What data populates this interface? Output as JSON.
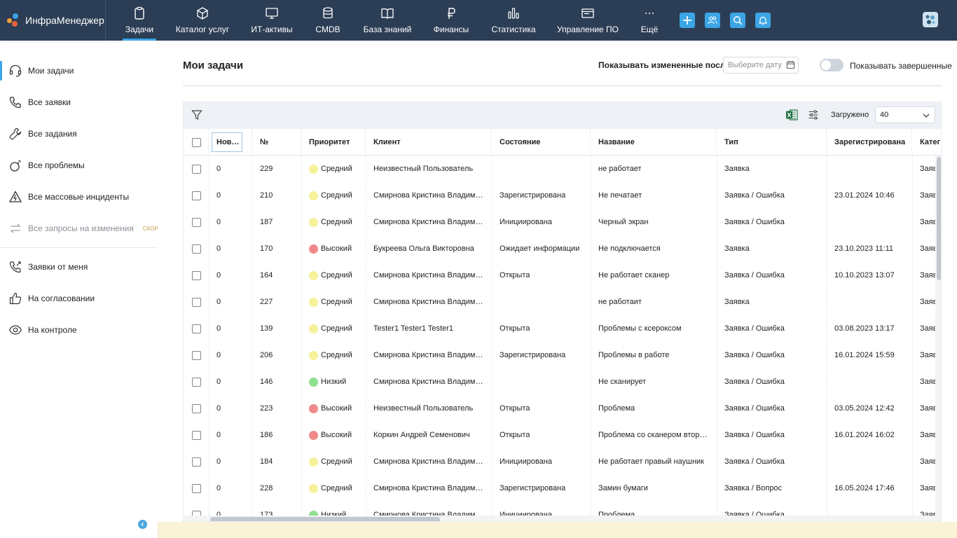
{
  "app": {
    "name": "ИнфраМенеджер"
  },
  "nav": [
    {
      "label": "Задачи",
      "icon": "clipboard-icon",
      "active": true
    },
    {
      "label": "Каталог услуг",
      "icon": "cube-icon"
    },
    {
      "label": "ИТ-активы",
      "icon": "monitor-icon"
    },
    {
      "label": "CMDB",
      "icon": "database-icon"
    },
    {
      "label": "База знаний",
      "icon": "book-icon"
    },
    {
      "label": "Финансы",
      "icon": "ruble-icon"
    },
    {
      "label": "Статистика",
      "icon": "bar-chart-icon"
    },
    {
      "label": "Управление ПО",
      "icon": "software-window-icon"
    },
    {
      "label": "Ещё",
      "icon": "more-icon"
    }
  ],
  "top_actions": [
    "plus-icon",
    "users-icon",
    "search-icon",
    "bell-icon"
  ],
  "sidebar": {
    "items": [
      {
        "label": "Мои задачи",
        "icon": "headset-icon",
        "active": true
      },
      {
        "label": "Все заявки",
        "icon": "phone-icon"
      },
      {
        "label": "Все задания",
        "icon": "wrench-icon"
      },
      {
        "label": "Все проблемы",
        "icon": "bomb-icon"
      },
      {
        "label": "Все массовые инциденты",
        "icon": "warning-bolt-icon"
      },
      {
        "label": "Все запросы на изменения",
        "icon": "swap-arrows-icon",
        "disabled": true,
        "badge": "СКОРО"
      },
      {
        "label": "Заявки от меня",
        "icon": "phone-outgoing-icon"
      },
      {
        "label": "На согласовании",
        "icon": "thumbs-up-icon"
      },
      {
        "label": "На контроле",
        "icon": "eye-icon"
      }
    ]
  },
  "header": {
    "title": "Мои задачи",
    "changed_after_label": "Показывать измененные после",
    "date_placeholder": "Выберите дату",
    "show_completed_label": "Показывать завершенные",
    "show_completed": false
  },
  "toolbar": {
    "loaded_label": "Загружено",
    "loaded_value": "40"
  },
  "colors": {
    "accent": "#3ba5e6",
    "topbar": "#2c3e55",
    "priority_medium": "#f7f19a",
    "priority_high": "#f08a8a",
    "priority_low": "#8fe08f"
  },
  "columns": [
    "Нов…",
    "№",
    "Приоритет",
    "Клиент",
    "Состояние",
    "Название",
    "Тип",
    "Зарегистрирована",
    "Катег"
  ],
  "rows": [
    {
      "new": "0",
      "num": "229",
      "priority": "Средний",
      "client": "Неизвестный Пользователь",
      "state": "",
      "name": "не работает",
      "type": "Заявка",
      "registered": "",
      "category": "Заяв"
    },
    {
      "new": "0",
      "num": "210",
      "priority": "Средний",
      "client": "Смирнова Кристина Владим…",
      "state": "Зарегистрирована",
      "name": "Не печатает",
      "type": "Заявка / Ошибка",
      "registered": "23.01.2024 10:46",
      "category": "Заяв"
    },
    {
      "new": "0",
      "num": "187",
      "priority": "Средний",
      "client": "Смирнова Кристина Владим…",
      "state": "Инициирована",
      "name": "Черный экран",
      "type": "Заявка / Ошибка",
      "registered": "",
      "category": "Заяв"
    },
    {
      "new": "0",
      "num": "170",
      "priority": "Высокий",
      "client": "Букреева Ольга Викторовна",
      "state": "Ожидает информации",
      "name": "Не подключается",
      "type": "Заявка",
      "registered": "23.10.2023 11:11",
      "category": "Заяв"
    },
    {
      "new": "0",
      "num": "164",
      "priority": "Средний",
      "client": "Смирнова Кристина Владим…",
      "state": "Открыта",
      "name": "Не работает сканер",
      "type": "Заявка / Ошибка",
      "registered": "10.10.2023 13:07",
      "category": "Заяв"
    },
    {
      "new": "0",
      "num": "227",
      "priority": "Средний",
      "client": "Смирнова Кристина Владим…",
      "state": "",
      "name": "не работаит",
      "type": "Заявка",
      "registered": "",
      "category": "Заяв"
    },
    {
      "new": "0",
      "num": "139",
      "priority": "Средний",
      "client": "Tester1 Tester1 Tester1",
      "state": "Открыта",
      "name": "Проблемы с ксероксом",
      "type": "Заявка / Ошибка",
      "registered": "03.08.2023 13:17",
      "category": "Заяв"
    },
    {
      "new": "0",
      "num": "206",
      "priority": "Средний",
      "client": "Смирнова Кристина Владим…",
      "state": "Зарегистрирована",
      "name": "Проблемы в работе",
      "type": "Заявка / Ошибка",
      "registered": "16.01.2024 15:59",
      "category": "Заяв"
    },
    {
      "new": "0",
      "num": "146",
      "priority": "Низкий",
      "client": "Смирнова Кристина Владим…",
      "state": "",
      "name": "Не сканирует",
      "type": "Заявка / Ошибка",
      "registered": "",
      "category": "Заяв"
    },
    {
      "new": "0",
      "num": "223",
      "priority": "Высокий",
      "client": "Неизвестный Пользователь",
      "state": "Открыта",
      "name": "Проблема",
      "type": "Заявка / Ошибка",
      "registered": "03.05.2024 12:42",
      "category": "Заяв"
    },
    {
      "new": "0",
      "num": "186",
      "priority": "Высокий",
      "client": "Коркин Андрей Семенович",
      "state": "Открыта",
      "name": "Проблема со сканером втор…",
      "type": "Заявка / Ошибка",
      "registered": "16.01.2024 16:02",
      "category": "Заяв"
    },
    {
      "new": "0",
      "num": "184",
      "priority": "Средний",
      "client": "Смирнова Кристина Владим…",
      "state": "Инициирована",
      "name": "Не работает правый наушник",
      "type": "Заявка / Ошибка",
      "registered": "",
      "category": "Заяв"
    },
    {
      "new": "0",
      "num": "228",
      "priority": "Средний",
      "client": "Смирнова Кристина Владим…",
      "state": "Зарегистрирована",
      "name": "Замин бумаги",
      "type": "Заявка / Вопрос",
      "registered": "16.05.2024 17:46",
      "category": "Заяв"
    },
    {
      "new": "0",
      "num": "173",
      "priority": "Низкий",
      "client": "Смирнова Кристина Владим…",
      "state": "Инициирована",
      "name": "Проблема",
      "type": "Заявка / Ошибка",
      "registered": "",
      "category": "Заяв"
    }
  ]
}
